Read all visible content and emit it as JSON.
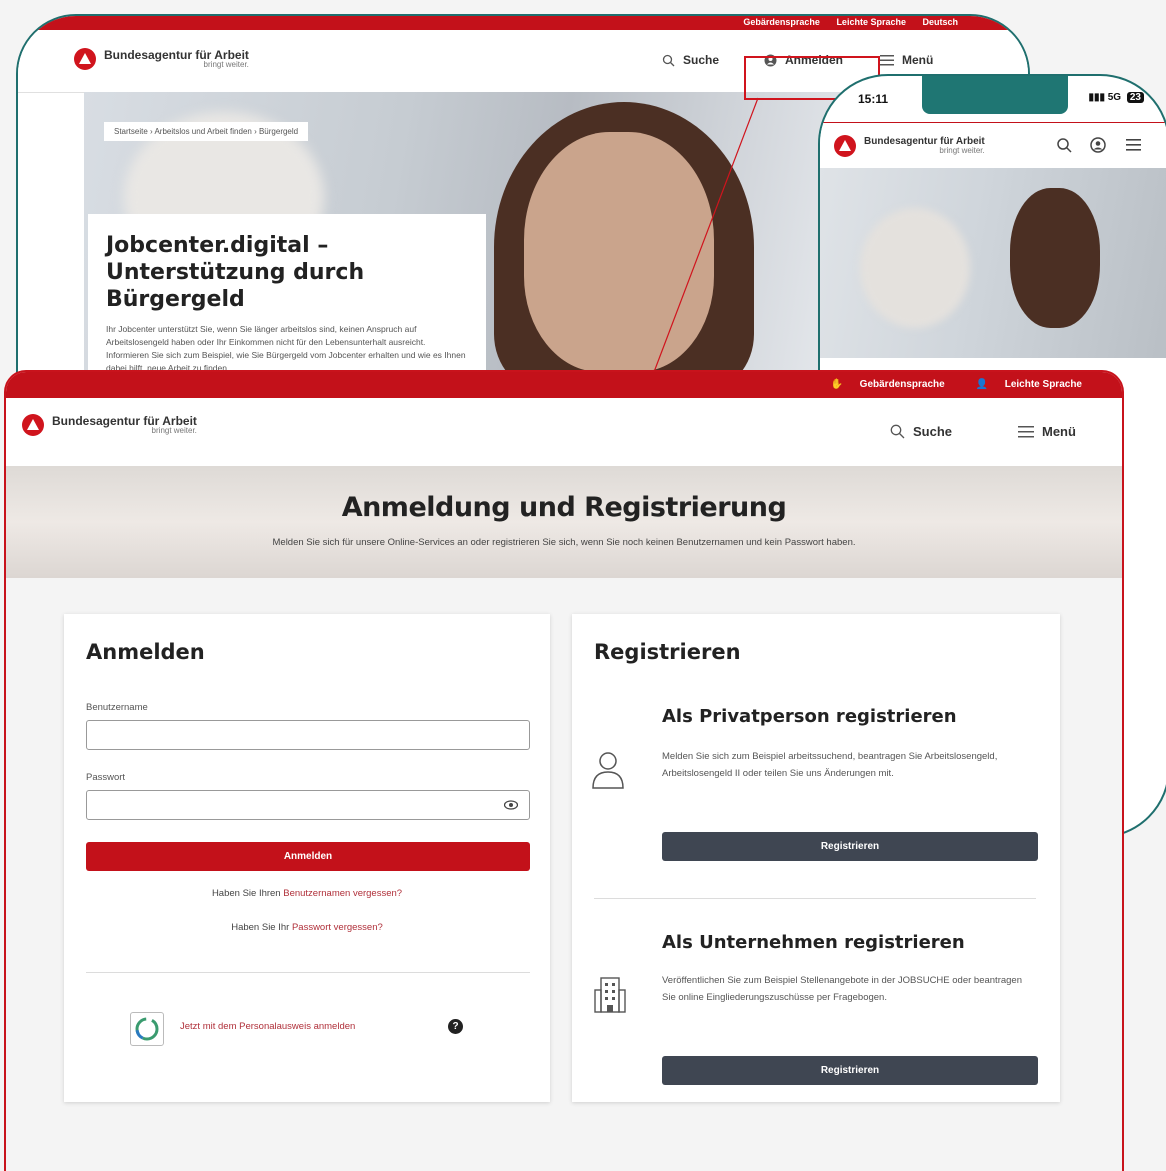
{
  "colors": {
    "brand_red": "#c3111a",
    "teal_frame": "#1f6f6e",
    "dark_button": "#3f4652"
  },
  "desktop": {
    "top_links": [
      "Gebärdensprache",
      "Leichte Sprache",
      "Deutsch"
    ],
    "logo_name": "Bundesagentur für Arbeit",
    "logo_tag": "bringt weiter.",
    "nav": {
      "search": "Suche",
      "login": "Anmelden",
      "menu": "Menü"
    },
    "breadcrumb": "Startseite  ›  Arbeitslos und Arbeit finden  ›  Bürgergeld",
    "hero_title": "Jobcenter.digital – Unterstützung durch Bürgergeld",
    "hero_text": "Ihr Jobcenter unterstützt Sie, wenn Sie länger arbeitslos sind, keinen Anspruch auf Arbeitslosengeld haben oder Ihr Einkommen nicht für den Lebensunterhalt ausreicht. Informieren Sie sich zum Beispiel, wie Sie Bürgergeld vom Jobcenter erhalten und wie es Ihnen dabei hilft, neue Arbeit zu finden."
  },
  "phone": {
    "time": "15:11",
    "signal": "5G",
    "battery": "23",
    "logo_name": "Bundesagentur für Arbeit",
    "logo_tag": "bringt weiter."
  },
  "front": {
    "top_links": [
      "Gebärdensprache",
      "Leichte Sprache"
    ],
    "logo_name": "Bundesagentur für Arbeit",
    "logo_tag": "bringt weiter.",
    "nav": {
      "search": "Suche",
      "menu": "Menü"
    },
    "banner_title": "Anmeldung und Registrierung",
    "banner_text": "Melden Sie sich für unsere Online-Services an oder registrieren Sie sich, wenn Sie noch keinen Benutzernamen und kein Passwort haben.",
    "login": {
      "title": "Anmelden",
      "username_label": "Benutzername",
      "username_value": "",
      "password_label": "Passwort",
      "password_value": "",
      "submit": "Anmelden",
      "forgot_user_prefix": "Haben Sie Ihren ",
      "forgot_user_link": "Benutzernamen vergessen?",
      "forgot_pw_prefix": "Haben Sie Ihr ",
      "forgot_pw_link": "Passwort vergessen?",
      "eid_link": "Jetzt mit dem Personalausweis anmelden",
      "help": "?"
    },
    "register": {
      "title": "Registrieren",
      "private_title": "Als Privatperson registrieren",
      "private_text": "Melden Sie sich zum Beispiel arbeitssuchend, beantragen Sie Arbeitslosengeld, Arbeitslosengeld II oder teilen Sie uns Änderungen mit.",
      "private_button": "Registrieren",
      "company_title": "Als Unternehmen registrieren",
      "company_text": "Veröffentlichen Sie zum Beispiel Stellenangebote in der JOBSUCHE oder beantragen Sie online Eingliederungszuschüsse per Fragebogen.",
      "company_button": "Registrieren"
    }
  }
}
